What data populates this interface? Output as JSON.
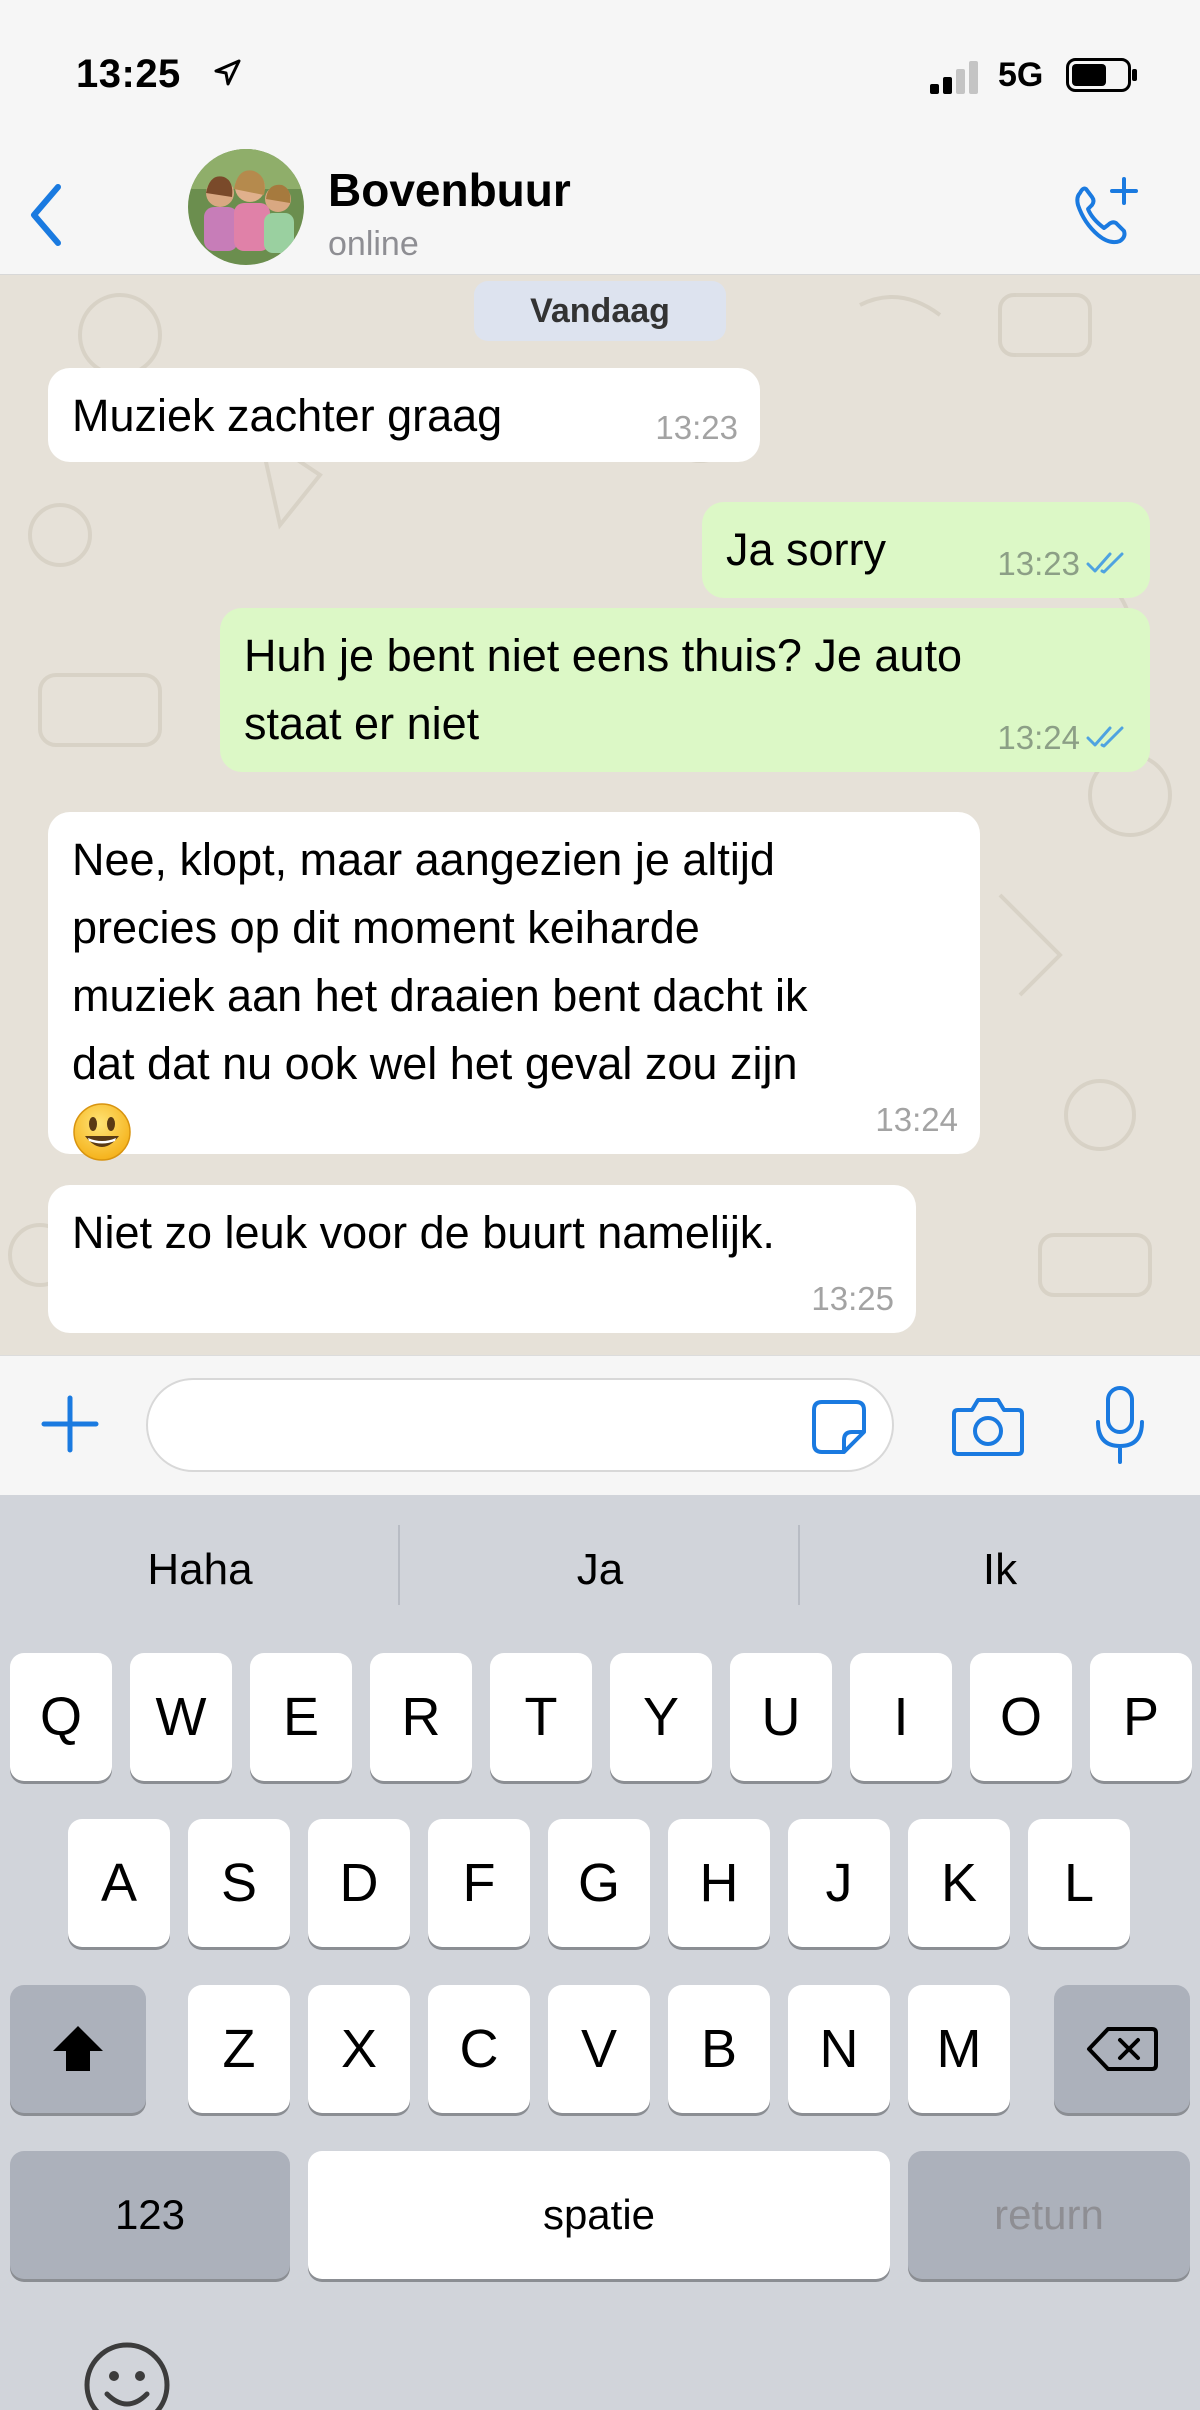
{
  "status_bar": {
    "time": "13:25",
    "network": "5G"
  },
  "header": {
    "contact_name": "Bovenbuur",
    "contact_status": "online"
  },
  "chat": {
    "day_label": "Vandaag",
    "messages": [
      {
        "direction": "in",
        "text": "Muziek zachter graag",
        "time": "13:23"
      },
      {
        "direction": "out",
        "text": "Ja sorry",
        "time": "13:23",
        "read": true
      },
      {
        "direction": "out",
        "lines": [
          "Huh je bent niet eens thuis? Je auto",
          "staat er niet"
        ],
        "time": "13:24",
        "read": true
      },
      {
        "direction": "in",
        "lines": [
          "Nee, klopt, maar aangezien je altijd",
          "precies op dit moment keiharde",
          "muziek aan het draaien bent dacht ik",
          "dat dat nu ook wel het geval zou zijn"
        ],
        "emoji": "smiling-face",
        "time": "13:24"
      },
      {
        "direction": "in",
        "text": "Niet zo leuk voor de buurt namelijk.",
        "time": "13:25"
      }
    ]
  },
  "input": {
    "placeholder": "",
    "value": ""
  },
  "keyboard": {
    "suggestions": [
      "Haha",
      "Ja",
      "Ik"
    ],
    "row1": [
      "Q",
      "W",
      "E",
      "R",
      "T",
      "Y",
      "U",
      "I",
      "O",
      "P"
    ],
    "row2": [
      "A",
      "S",
      "D",
      "F",
      "G",
      "H",
      "J",
      "K",
      "L"
    ],
    "row3": [
      "Z",
      "X",
      "C",
      "V",
      "B",
      "N",
      "M"
    ],
    "numbers_label": "123",
    "space_label": "spatie",
    "return_label": "return"
  },
  "colors": {
    "accent": "#1a7ae0",
    "outgoing_bubble": "#dcf8c6",
    "incoming_bubble": "#ffffff",
    "chat_background": "#e6e1d8",
    "read_ticks": "#4fa3e0"
  },
  "icons": [
    "location-arrow-icon",
    "signal-icon",
    "battery-icon",
    "back-chevron-icon",
    "add-call-icon",
    "plus-icon",
    "sticker-icon",
    "camera-icon",
    "microphone-icon",
    "shift-icon",
    "backspace-icon",
    "emoji-icon",
    "double-check-icon"
  ]
}
